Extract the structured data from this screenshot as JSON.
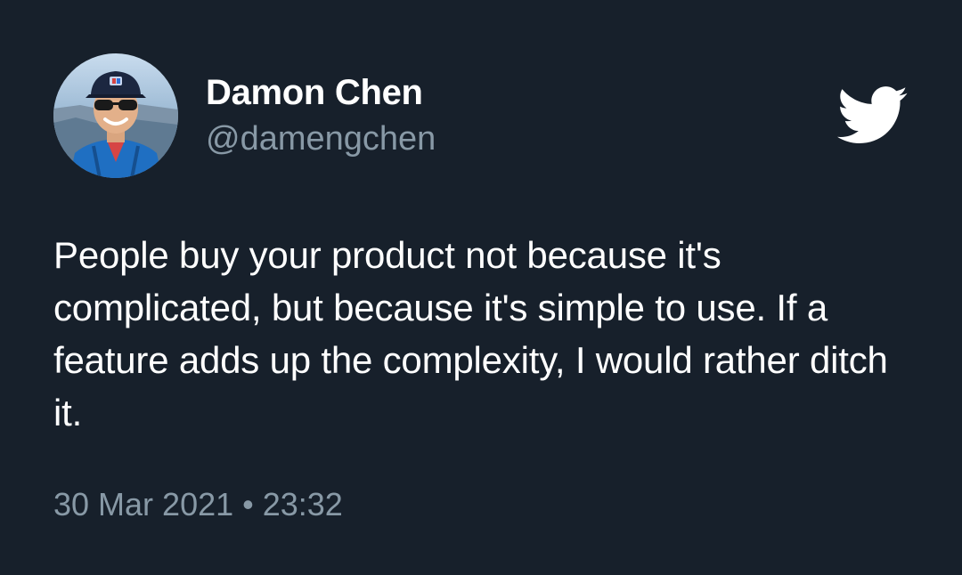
{
  "author": {
    "display_name": "Damon Chen",
    "handle": "@damengchen",
    "avatar_icon": "user-avatar-photo"
  },
  "brand": {
    "icon": "twitter-bird-icon",
    "color": "#ffffff"
  },
  "tweet": {
    "text": "People buy your product not because it's complicated, but because it's simple to use. If a feature adds up the complexity, I would rather ditch it.",
    "timestamp": "30 Mar 2021 • 23:32"
  },
  "colors": {
    "background": "#17202b",
    "primary_text": "#ffffff",
    "secondary_text": "#8899a6"
  }
}
